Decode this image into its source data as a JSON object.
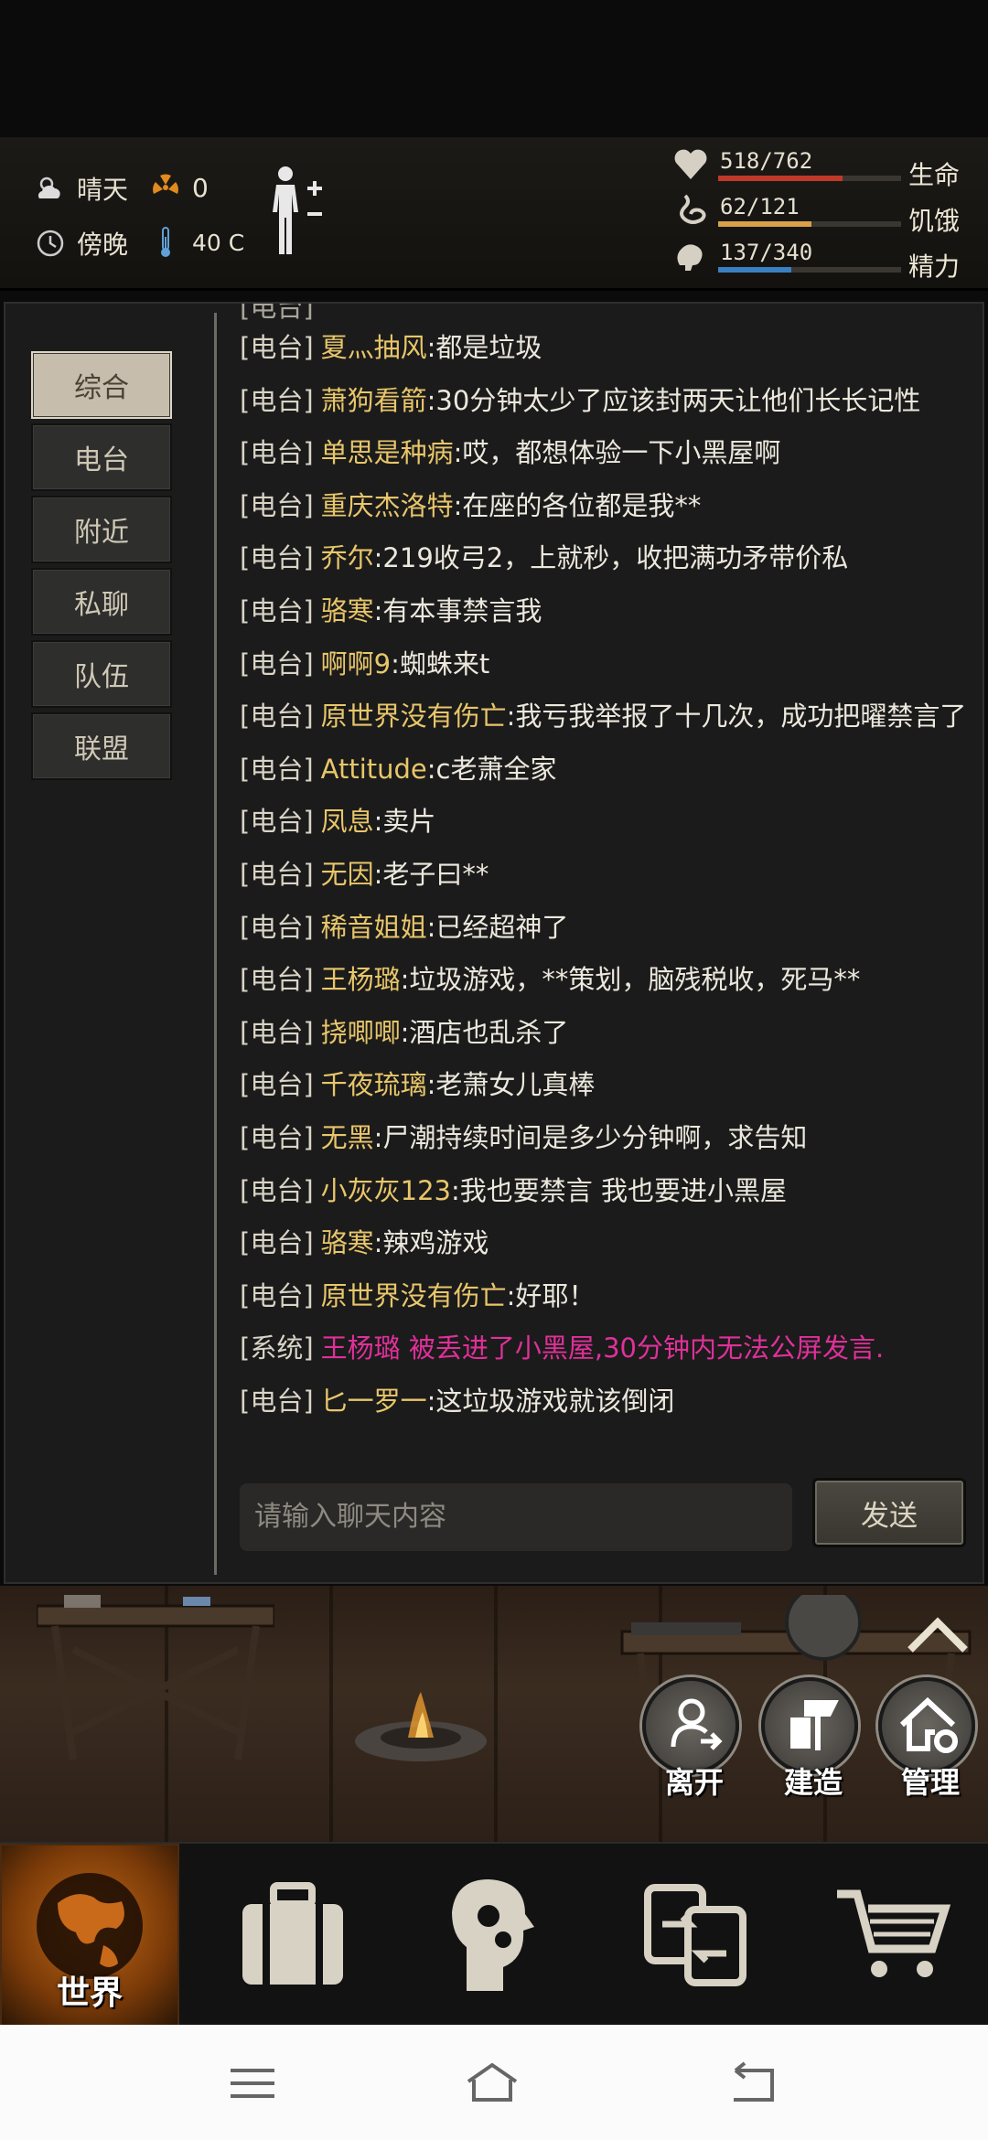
{
  "status": {
    "weather": "晴天",
    "radiation": "0",
    "time_of_day": "傍晚",
    "temperature": "40 C"
  },
  "vitals": [
    {
      "value": "518/762",
      "label": "生命",
      "fraction": 0.68,
      "color": "#c0392b",
      "icon": "heart-icon"
    },
    {
      "value": "62/121",
      "label": "饥饿",
      "fraction": 0.51,
      "color": "#d9a14a",
      "icon": "stomach-icon"
    },
    {
      "value": "137/340",
      "label": "精力",
      "fraction": 0.4,
      "color": "#3a7fc0",
      "icon": "brain-icon"
    }
  ],
  "tabs": [
    "综合",
    "电台",
    "附近",
    "私聊",
    "队伍",
    "联盟"
  ],
  "active_tab": "综合",
  "messages": [
    {
      "ch": "[电台]",
      "name": "夏灬抽风",
      "txt": ":都是垃圾"
    },
    {
      "ch": "[电台]",
      "name": "萧狗看箭",
      "txt": ":30分钟太少了应该封两天让他们长长记性"
    },
    {
      "ch": "[电台]",
      "name": "单思是种病",
      "txt": ":哎，都想体验一下小黑屋啊"
    },
    {
      "ch": "[电台]",
      "name": "重庆杰洛特",
      "txt": ":在座的各位都是我**"
    },
    {
      "ch": "[电台]",
      "name": "乔尔",
      "txt": ":219收弓2，上就秒，收把满功矛带价私"
    },
    {
      "ch": "[电台]",
      "name": "骆寒",
      "txt": ":有本事禁言我"
    },
    {
      "ch": "[电台]",
      "name": "啊啊9",
      "txt": ":蜘蛛来t"
    },
    {
      "ch": "[电台]",
      "name": "原世界没有伤亡",
      "txt": ":我亏我举报了十几次，成功把曜禁言了"
    },
    {
      "ch": "[电台]",
      "name": "Attitude",
      "txt": ":c老萧全家"
    },
    {
      "ch": "[电台]",
      "name": "凤息",
      "txt": ":卖片"
    },
    {
      "ch": "[电台]",
      "name": "无因",
      "txt": ":老子曰**"
    },
    {
      "ch": "[电台]",
      "name": "稀音姐姐",
      "txt": ":已经超神了"
    },
    {
      "ch": "[电台]",
      "name": "王杨璐",
      "txt": ":垃圾游戏，**策划，脑残税收，死马**"
    },
    {
      "ch": "[电台]",
      "name": "挠唧唧",
      "txt": ":酒店也乱杀了"
    },
    {
      "ch": "[电台]",
      "name": "千夜琉璃",
      "txt": ":老萧女儿真棒"
    },
    {
      "ch": "[电台]",
      "name": "无黑",
      "txt": ":尸潮持续时间是多少分钟啊，求告知"
    },
    {
      "ch": "[电台]",
      "name": "小灰灰123",
      "txt": ":我也要禁言 我也要进小黑屋"
    },
    {
      "ch": "[电台]",
      "name": "骆寒",
      "txt": ":辣鸡游戏"
    },
    {
      "ch": "[电台]",
      "name": "原世界没有伤亡",
      "txt": ":好耶！"
    },
    {
      "ch": "[系统]",
      "name": "王杨璐",
      "txt": " 被丢进了小黑屋,30分钟内无法公屏发言.",
      "system": true
    },
    {
      "ch": "[电台]",
      "name": "匕一罗一",
      "txt": ":这垃圾游戏就该倒闭"
    }
  ],
  "chat": {
    "placeholder": "请输入聊天内容",
    "send_label": "发送"
  },
  "scene_actions": [
    {
      "label": "离开",
      "icon": "leave-icon"
    },
    {
      "label": "建造",
      "icon": "build-icon"
    },
    {
      "label": "管理",
      "icon": "manage-icon"
    }
  ],
  "nav": {
    "items": [
      {
        "label": "世界",
        "icon": "globe-icon"
      },
      {
        "label": "",
        "icon": "suitcase-icon"
      },
      {
        "label": "",
        "icon": "head-gears-icon"
      },
      {
        "label": "",
        "icon": "trade-icon"
      },
      {
        "label": "",
        "icon": "cart-icon"
      }
    ]
  }
}
